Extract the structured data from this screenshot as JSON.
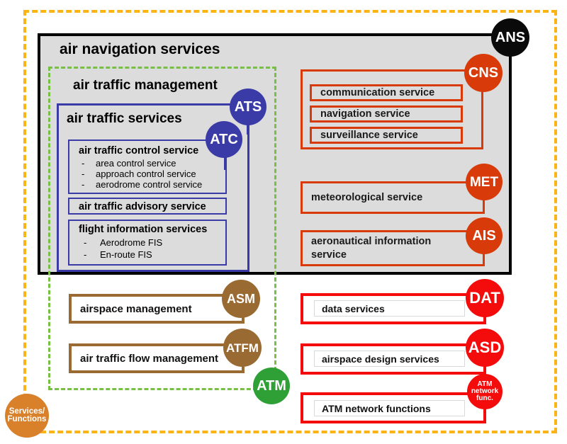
{
  "diagram": {
    "title_ans": "air navigation services",
    "title_atm": "air traffic management",
    "title_ats": "air traffic services",
    "outer_legend": "Services/\nFunctions",
    "legend_line1": "Services/",
    "legend_line2": "Functions"
  },
  "colors": {
    "outer_frame": "#FBB416",
    "ans_border": "#000000",
    "ans_fill": "#DCDCDC",
    "atm_dashed": "#77C043",
    "ats_blue": "#3B3BA8",
    "cns_dark_red": "#D83A0A",
    "bright_red": "#F40B0B",
    "brown": "#9A6A33",
    "green_badge": "#2FA036",
    "orange_badge": "#D9802A",
    "black_badge": "#0A0A0A"
  },
  "badges": {
    "ans": "ANS",
    "atm": "ATM",
    "ats": "ATS",
    "atc": "ATC",
    "cns": "CNS",
    "met": "MET",
    "ais": "AIS",
    "asm": "ASM",
    "atfm": "ATFM",
    "dat": "DAT",
    "asd": "ASD",
    "atm_network_func_line1": "ATM",
    "atm_network_func_line2": "network",
    "atm_network_func_line3": "func."
  },
  "ats_group": {
    "atc": {
      "title": "air traffic control service",
      "dash": "-",
      "items": [
        "area control service",
        "approach control service",
        "aerodrome control service"
      ]
    },
    "advisory": {
      "title": "air traffic advisory service"
    },
    "fis": {
      "title": "flight information services",
      "dash": "-",
      "items": [
        "Aerodrome FIS",
        "En-route FIS"
      ]
    }
  },
  "cns_group": {
    "items": [
      "communication service",
      "navigation service",
      "surveillance service"
    ]
  },
  "right_services": {
    "met": "meteorological service",
    "ais": "aeronautical information service"
  },
  "atm_services": {
    "asm": "airspace management",
    "atfm": "air traffic flow management"
  },
  "bottom_services": {
    "dat": "data services",
    "asd": "airspace design services",
    "anf": "ATM network functions"
  }
}
